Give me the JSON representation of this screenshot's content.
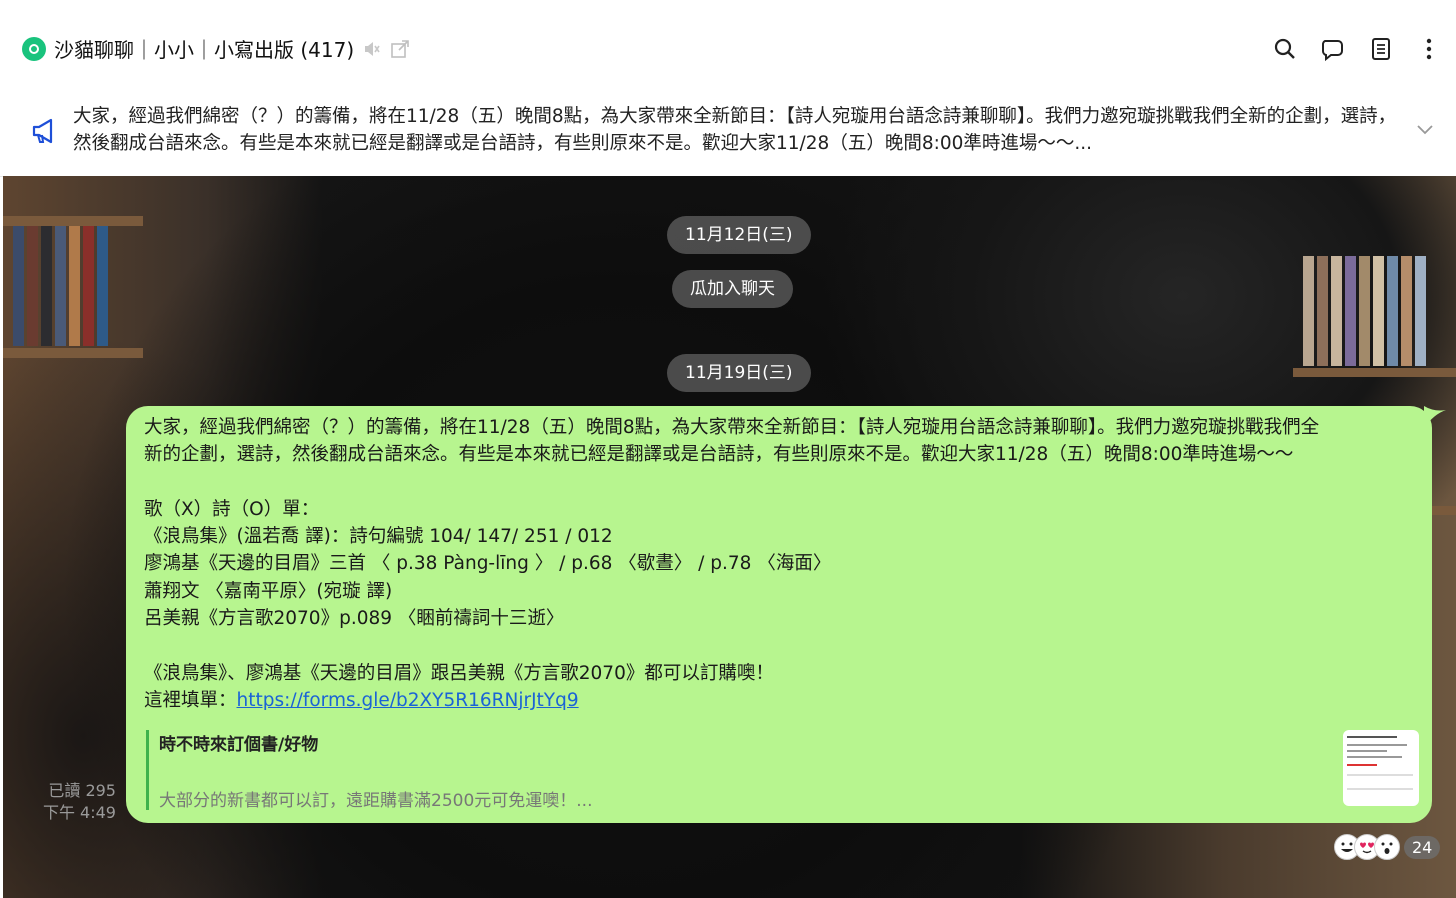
{
  "header": {
    "title": "沙貓聊聊｜小小｜小寫出版 (417)",
    "icons": [
      "search-icon",
      "chat-icon",
      "notes-icon",
      "more-icon"
    ]
  },
  "announcement": {
    "text": "大家，經過我們綿密（？）的籌備，將在11/28（五）晚間8點，為大家帶來全新節目：【詩人宛璇用台語念詩兼聊聊】。我們力邀宛璇挑戰我們全新的企劃，選詩，然後翻成台語來念。有些是本來就已經是翻譯或是台語詩，有些則原來不是。歡迎大家11/28（五）晚間8:00準時進場～～..."
  },
  "chat": {
    "date1": "11月12日(三)",
    "system_msg": "瓜加入聊天",
    "date2": "11月19日(三)",
    "message": {
      "line1": "大家，經過我們綿密（？）的籌備，將在11/28（五）晚間8點，為大家帶來全新節目：【詩人宛璇用台語念詩兼聊聊】。我們力邀宛璇挑戰我們全",
      "line2": "新的企劃，選詩，然後翻成台語來念。有些是本來就已經是翻譯或是台語詩，有些則原來不是。歡迎大家11/28（五）晚間8:00準時進場～～",
      "list_title": "歌（X）詩（O）單：",
      "list": [
        "《浪鳥集》(溫若喬 譯)：詩句編號 104/ 147/ 251 / 012",
        "廖鴻基《天邊的目眉》三首 〈 p.38 Pàng-līng 〉 / p.68 〈歇晝〉 / p.78 〈海面〉",
        "蕭翔文 〈嘉南平原〉(宛璇 譯)",
        "呂美親《方言歌2070》p.089 〈睏前禱詞十三逝〉"
      ],
      "order_line": "《浪鳥集》、廖鴻基《天邊的目眉》跟呂美親《方言歌2070》都可以訂購噢！",
      "form_label": "這裡填單：",
      "form_link": "https://forms.gle/b2XY5R16RNjrJtYq9",
      "preview_title": "時不時來訂個書/好物",
      "preview_desc": "大部分的新書都可以訂，遠距購書滿2500元可免運噢！...",
      "read_count": "已讀 295",
      "time": "下午 4:49",
      "reaction_count": "24"
    }
  },
  "colors": {
    "bubble": "#b7f58f",
    "link": "#1a63d6",
    "logo": "#19c37d"
  }
}
